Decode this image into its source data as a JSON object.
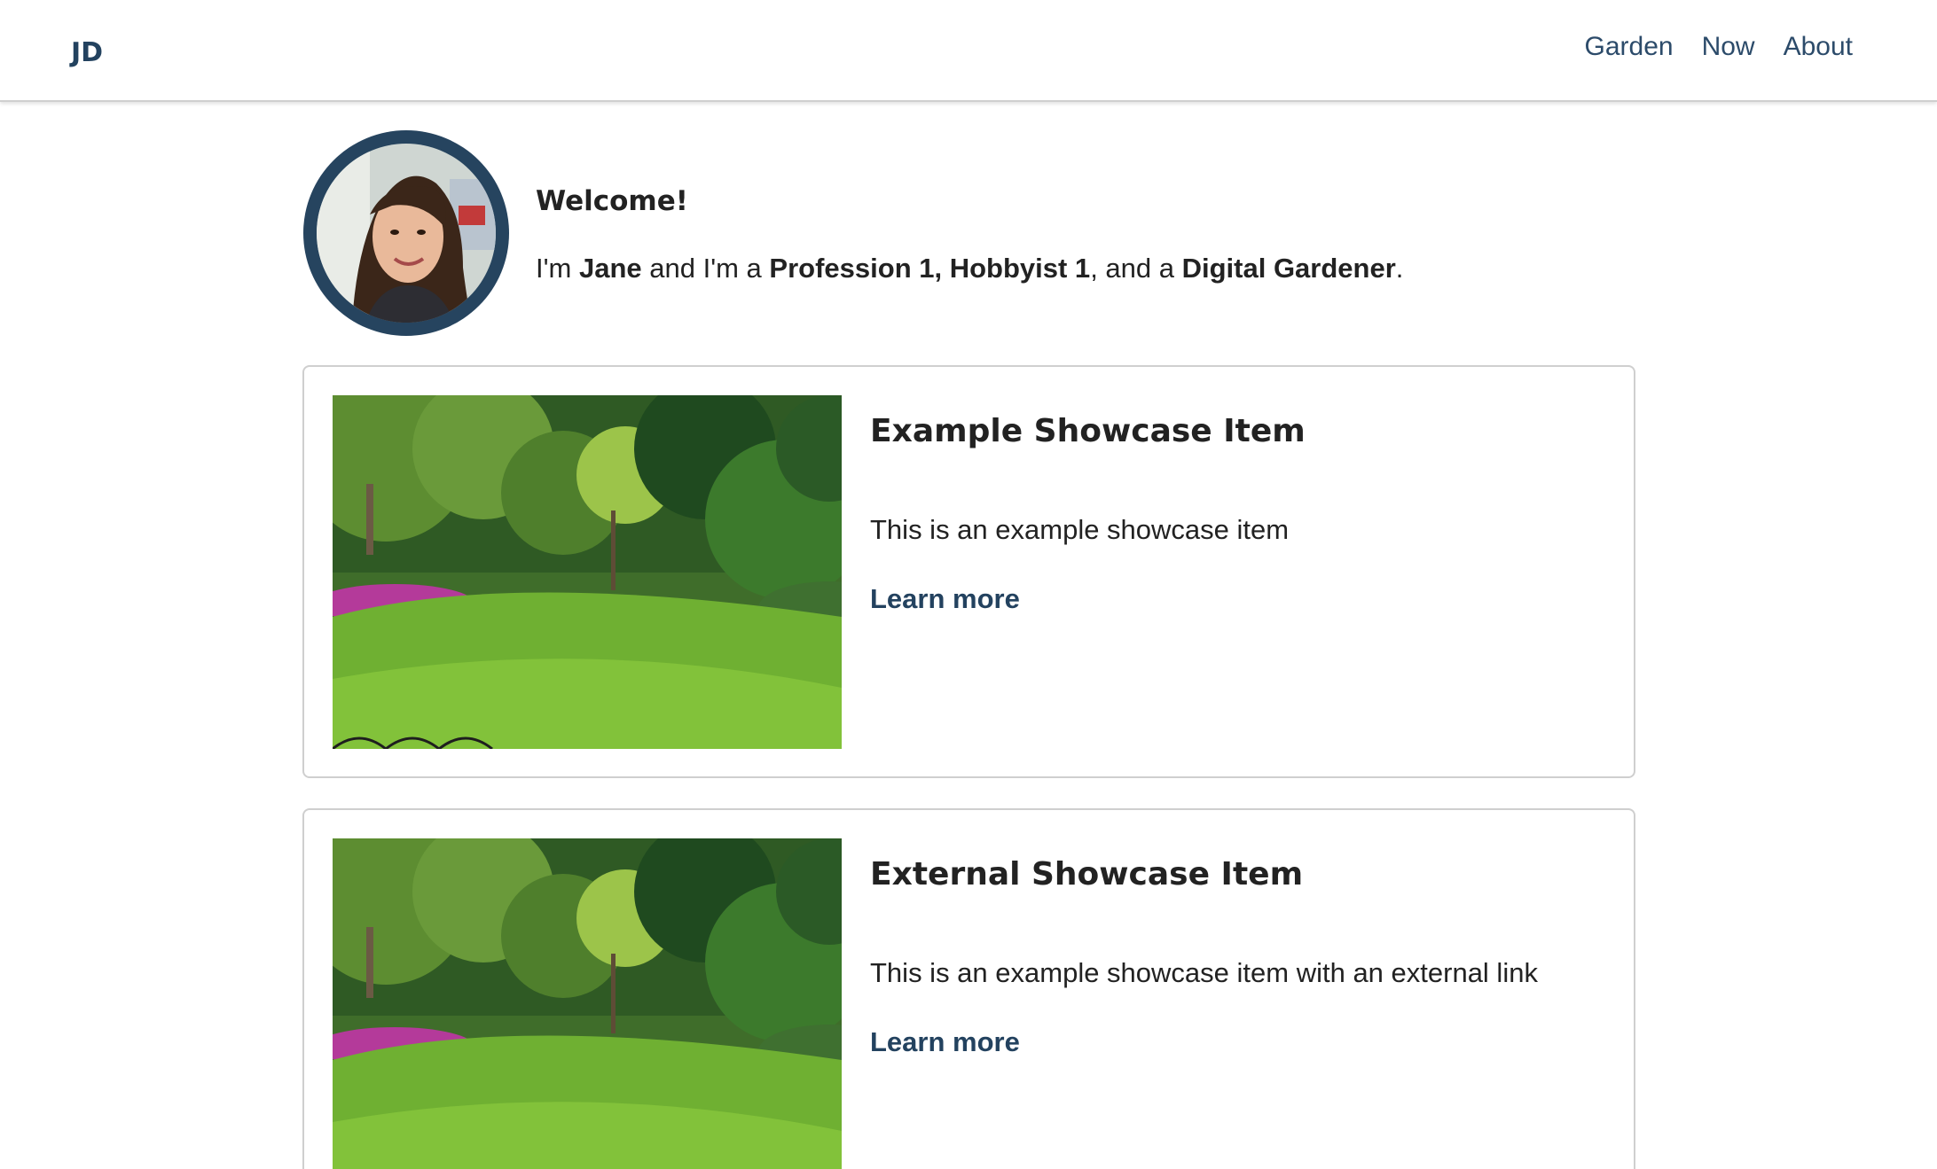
{
  "header": {
    "logo": "JD",
    "nav": [
      {
        "label": "Garden"
      },
      {
        "label": "Now"
      },
      {
        "label": "About"
      }
    ]
  },
  "intro": {
    "heading": "Welcome!",
    "bio": {
      "prefix": "I'm ",
      "name": "Jane",
      "middle": " and I'm a ",
      "roles": "Profession 1, Hobbyist 1",
      "connector": ", and a ",
      "title": "Digital Gardener",
      "suffix": "."
    }
  },
  "showcase": [
    {
      "title": "Example Showcase Item",
      "description": "This is an example showcase item",
      "link_label": "Learn more"
    },
    {
      "title": "External Showcase Item",
      "description": "This is an example showcase item with an external link",
      "link_label": "Learn more"
    }
  ],
  "colors": {
    "accent": "#23425f",
    "text": "#222222",
    "border": "#cfcfcf"
  }
}
